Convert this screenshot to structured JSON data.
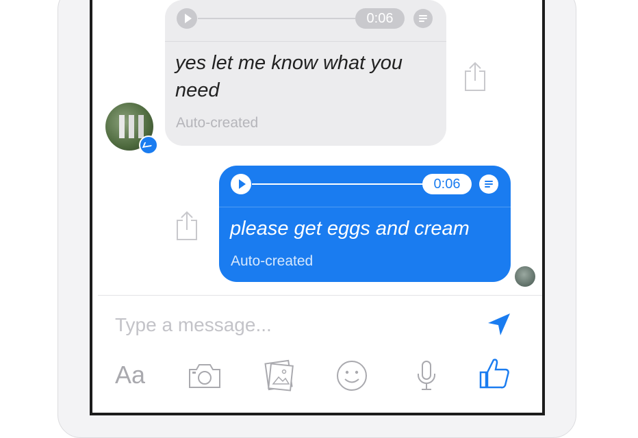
{
  "conversation": {
    "incoming": {
      "duration": "0:06",
      "transcript": "yes let me know what you need",
      "label": "Auto-created"
    },
    "outgoing": {
      "duration": "0:06",
      "transcript": "please get eggs and cream",
      "label": "Auto-created"
    }
  },
  "composer": {
    "placeholder": "Type a message..."
  },
  "toolbar": {
    "text_format_label": "Aa",
    "icons": [
      "camera-icon",
      "gallery-icon",
      "emoji-icon",
      "microphone-icon",
      "like-icon"
    ]
  },
  "colors": {
    "accent": "#1a7cf0",
    "incoming_bubble": "#ececee",
    "muted": "#b5b5ba"
  }
}
